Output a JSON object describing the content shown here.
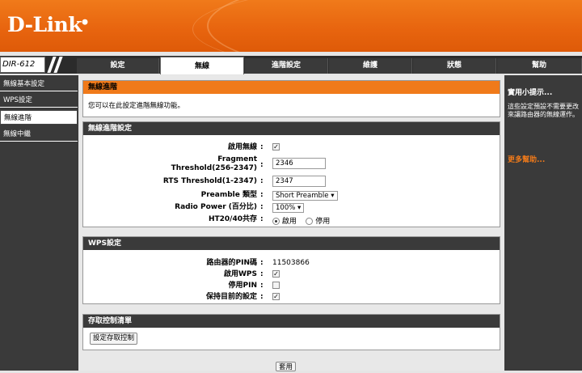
{
  "brand": "D-Link",
  "model": "DIR-612",
  "nav_tabs": [
    {
      "label": "設定"
    },
    {
      "label": "無線"
    },
    {
      "label": "進階設定"
    },
    {
      "label": "維護"
    },
    {
      "label": "狀態"
    },
    {
      "label": "幫助"
    }
  ],
  "sidebar": {
    "items": [
      {
        "label": "無線基本設定"
      },
      {
        "label": "WPS設定"
      },
      {
        "label": "無線進階"
      },
      {
        "label": "無線中繼"
      }
    ]
  },
  "intro": {
    "title": "無線進階",
    "text": "您可以在此設定進階無線功能。"
  },
  "advanced": {
    "title": "無線進階設定",
    "enable_wireless_label": "啟用無線",
    "frag_label": "Fragment Threshold(256-2347)",
    "frag_value": "2346",
    "rts_label": "RTS Threshold(1-2347)",
    "rts_value": "2347",
    "preamble_label": "Preamble 類型",
    "preamble_value": "Short Preamble",
    "power_label": "Radio Power (百分比)",
    "power_value": "100%",
    "ht_label": "HT20/40共存",
    "ht_on": "啟用",
    "ht_off": "停用"
  },
  "wps": {
    "title": "WPS設定",
    "pin_label": "路由器的PIN碼",
    "pin_value": "11503866",
    "enable_wps_label": "啟用WPS",
    "disable_pin_label": "停用PIN",
    "keep_label": "保持目前的設定"
  },
  "acl": {
    "title": "存取控制清單",
    "button": "設定存取控制"
  },
  "apply_label": "套用",
  "hints": {
    "title": "實用小提示...",
    "text": "這些設定預設不需要更改來讓路由器的無線運作。",
    "more": "更多幫助..."
  },
  "colors": {
    "orange": "#f07a1a",
    "dark": "#3a3a3a"
  }
}
